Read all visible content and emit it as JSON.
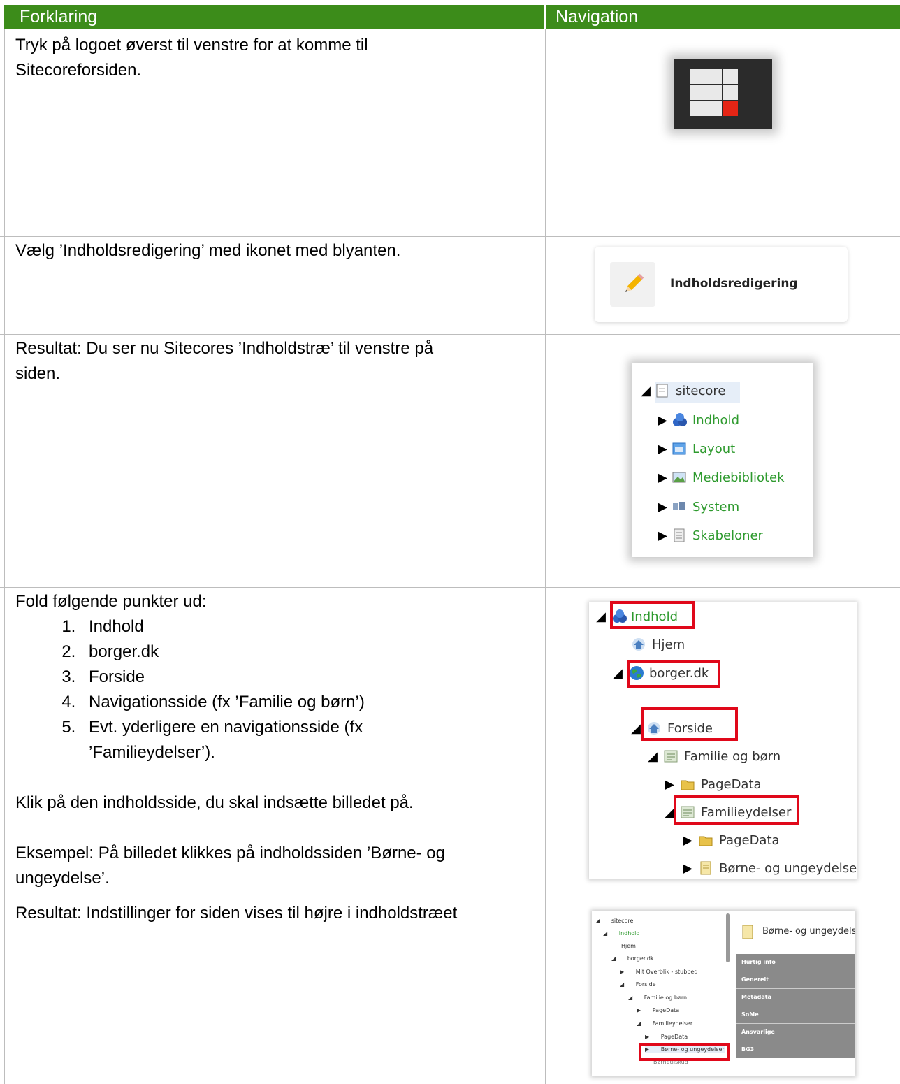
{
  "header": {
    "col1": "Forklaring",
    "col2": "Navigation"
  },
  "row1": {
    "text": "Tryk på logoet øverst til venstre for at komme til Sitecoreforsiden.",
    "text_line1": "Tryk på logoet øverst til venstre for at komme til",
    "text_line2": "Sitecoreforsiden."
  },
  "row2": {
    "text": "Vælg ’Indholdsredigering’ med ikonet med blyanten.",
    "button_label": "Indholdsredigering"
  },
  "row3": {
    "text_line1": "Resultat: Du ser nu Sitecores ’Indholdstræ’ til venstre på",
    "text_line2": "siden.",
    "tree": [
      "sitecore",
      "Indhold",
      "Layout",
      "Mediebibliotek",
      "System",
      "Skabeloner"
    ]
  },
  "row4": {
    "intro": "Fold følgende punkter ud:",
    "steps": [
      "Indhold",
      "borger.dk",
      "Forside",
      "Navigationsside (fx ’Familie og børn’)",
      "Evt. yderligere en navigationsside (fx",
      "’Familieydelser’)."
    ],
    "click_text": "Klik på den indholdsside, du skal indsætte billedet på.",
    "example_line1": "Eksempel: På billedet klikkes på indholdssiden ’Børne- og",
    "example_line2": "ungeydelse’.",
    "tree": [
      "Indhold",
      "Hjem",
      "borger.dk",
      "Forside",
      "Familie og børn",
      "PageData",
      "Familieydelser",
      "PageData",
      "Børne- og ungeydelse"
    ]
  },
  "row5": {
    "text": "Resultat: Indstillinger for siden vises til højre i indholdstræet",
    "tree": [
      "sitecore",
      "Indhold",
      "Hjem",
      "borger.dk",
      "Mit Overblik - stubbed",
      "Forside",
      "Familie og børn",
      "PageData",
      "Familieydelser",
      "PageData",
      "Børne- og ungeydelser",
      "Børnetilskud"
    ],
    "panel_title": "Børne- og ungeydelse",
    "sections": [
      "Hurtig info",
      "Generelt",
      "Metadata",
      "SoMe",
      "Ansvarlige",
      "BG3"
    ]
  }
}
